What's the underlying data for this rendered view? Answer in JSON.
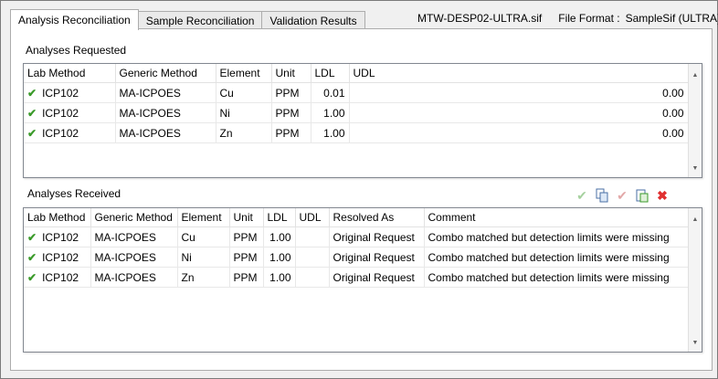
{
  "tabs": [
    {
      "label": "Analysis Reconciliation",
      "active": true
    },
    {
      "label": "Sample Reconciliation",
      "active": false
    },
    {
      "label": "Validation Results",
      "active": false
    }
  ],
  "file": {
    "name": "MTW-DESP02-ULTRA.sif",
    "format_label": "File Format :",
    "format_value": "SampleSif (ULTRA)"
  },
  "requested": {
    "title": "Analyses Requested",
    "columns": [
      "Lab Method",
      "Generic Method",
      "Element",
      "Unit",
      "LDL",
      "UDL"
    ],
    "rows": [
      {
        "lab_method": "ICP102",
        "generic_method": "MA-ICPOES",
        "element": "Cu",
        "unit": "PPM",
        "ldl": "0.01",
        "udl": "0.00"
      },
      {
        "lab_method": "ICP102",
        "generic_method": "MA-ICPOES",
        "element": "Ni",
        "unit": "PPM",
        "ldl": "1.00",
        "udl": "0.00"
      },
      {
        "lab_method": "ICP102",
        "generic_method": "MA-ICPOES",
        "element": "Zn",
        "unit": "PPM",
        "ldl": "1.00",
        "udl": "0.00"
      }
    ]
  },
  "received": {
    "title": "Analyses Received",
    "columns": [
      "Lab Method",
      "Generic Method",
      "Element",
      "Unit",
      "LDL",
      "UDL",
      "Resolved As",
      "Comment"
    ],
    "rows": [
      {
        "lab_method": "ICP102",
        "generic_method": "MA-ICPOES",
        "element": "Cu",
        "unit": "PPM",
        "ldl": "1.00",
        "udl": "",
        "resolved_as": "Original Request",
        "comment": "Combo matched but detection limits were missing"
      },
      {
        "lab_method": "ICP102",
        "generic_method": "MA-ICPOES",
        "element": "Ni",
        "unit": "PPM",
        "ldl": "1.00",
        "udl": "",
        "resolved_as": "Original Request",
        "comment": "Combo matched but detection limits were missing"
      },
      {
        "lab_method": "ICP102",
        "generic_method": "MA-ICPOES",
        "element": "Zn",
        "unit": "PPM",
        "ldl": "1.00",
        "udl": "",
        "resolved_as": "Original Request",
        "comment": "Combo matched but detection limits were missing"
      }
    ]
  },
  "toolbar": [
    {
      "icon": "check-icon",
      "enabled": false
    },
    {
      "icon": "copy-icon",
      "enabled": true
    },
    {
      "icon": "check-icon",
      "enabled": false
    },
    {
      "icon": "paste-icon",
      "enabled": true
    },
    {
      "icon": "delete-icon",
      "enabled": true
    }
  ],
  "colors": {
    "check_green": "#3a9a2a",
    "delete_red": "#e03030",
    "tab_border": "#acacac"
  }
}
